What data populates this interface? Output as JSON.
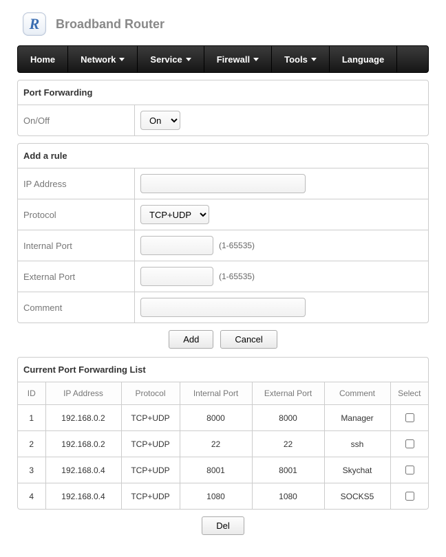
{
  "header": {
    "title": "Broadband Router",
    "logo_letter": "R"
  },
  "nav": {
    "items": [
      {
        "label": "Home",
        "dropdown": false
      },
      {
        "label": "Network",
        "dropdown": true
      },
      {
        "label": "Service",
        "dropdown": true
      },
      {
        "label": "Firewall",
        "dropdown": true
      },
      {
        "label": "Tools",
        "dropdown": true
      },
      {
        "label": "Language",
        "dropdown": false
      }
    ]
  },
  "port_forwarding": {
    "title": "Port Forwarding",
    "onoff_label": "On/Off",
    "onoff_value": "On"
  },
  "add_rule": {
    "title": "Add a rule",
    "ip_label": "IP Address",
    "ip_value": "",
    "protocol_label": "Protocol",
    "protocol_value": "TCP+UDP",
    "internal_port_label": "Internal Port",
    "internal_port_value": "",
    "internal_port_hint": "(1-65535)",
    "external_port_label": "External Port",
    "external_port_value": "",
    "external_port_hint": "(1-65535)",
    "comment_label": "Comment",
    "comment_value": ""
  },
  "buttons": {
    "add": "Add",
    "cancel": "Cancel",
    "del": "Del"
  },
  "list": {
    "title": "Current Port Forwarding List",
    "headers": {
      "id": "ID",
      "ip": "IP Address",
      "protocol": "Protocol",
      "internal": "Internal Port",
      "external": "External Port",
      "comment": "Comment",
      "select": "Select"
    },
    "rows": [
      {
        "id": "1",
        "ip": "192.168.0.2",
        "protocol": "TCP+UDP",
        "internal": "8000",
        "external": "8000",
        "comment": "Manager"
      },
      {
        "id": "2",
        "ip": "192.168.0.2",
        "protocol": "TCP+UDP",
        "internal": "22",
        "external": "22",
        "comment": "ssh"
      },
      {
        "id": "3",
        "ip": "192.168.0.4",
        "protocol": "TCP+UDP",
        "internal": "8001",
        "external": "8001",
        "comment": "Skychat"
      },
      {
        "id": "4",
        "ip": "192.168.0.4",
        "protocol": "TCP+UDP",
        "internal": "1080",
        "external": "1080",
        "comment": "SOCKS5"
      }
    ]
  }
}
